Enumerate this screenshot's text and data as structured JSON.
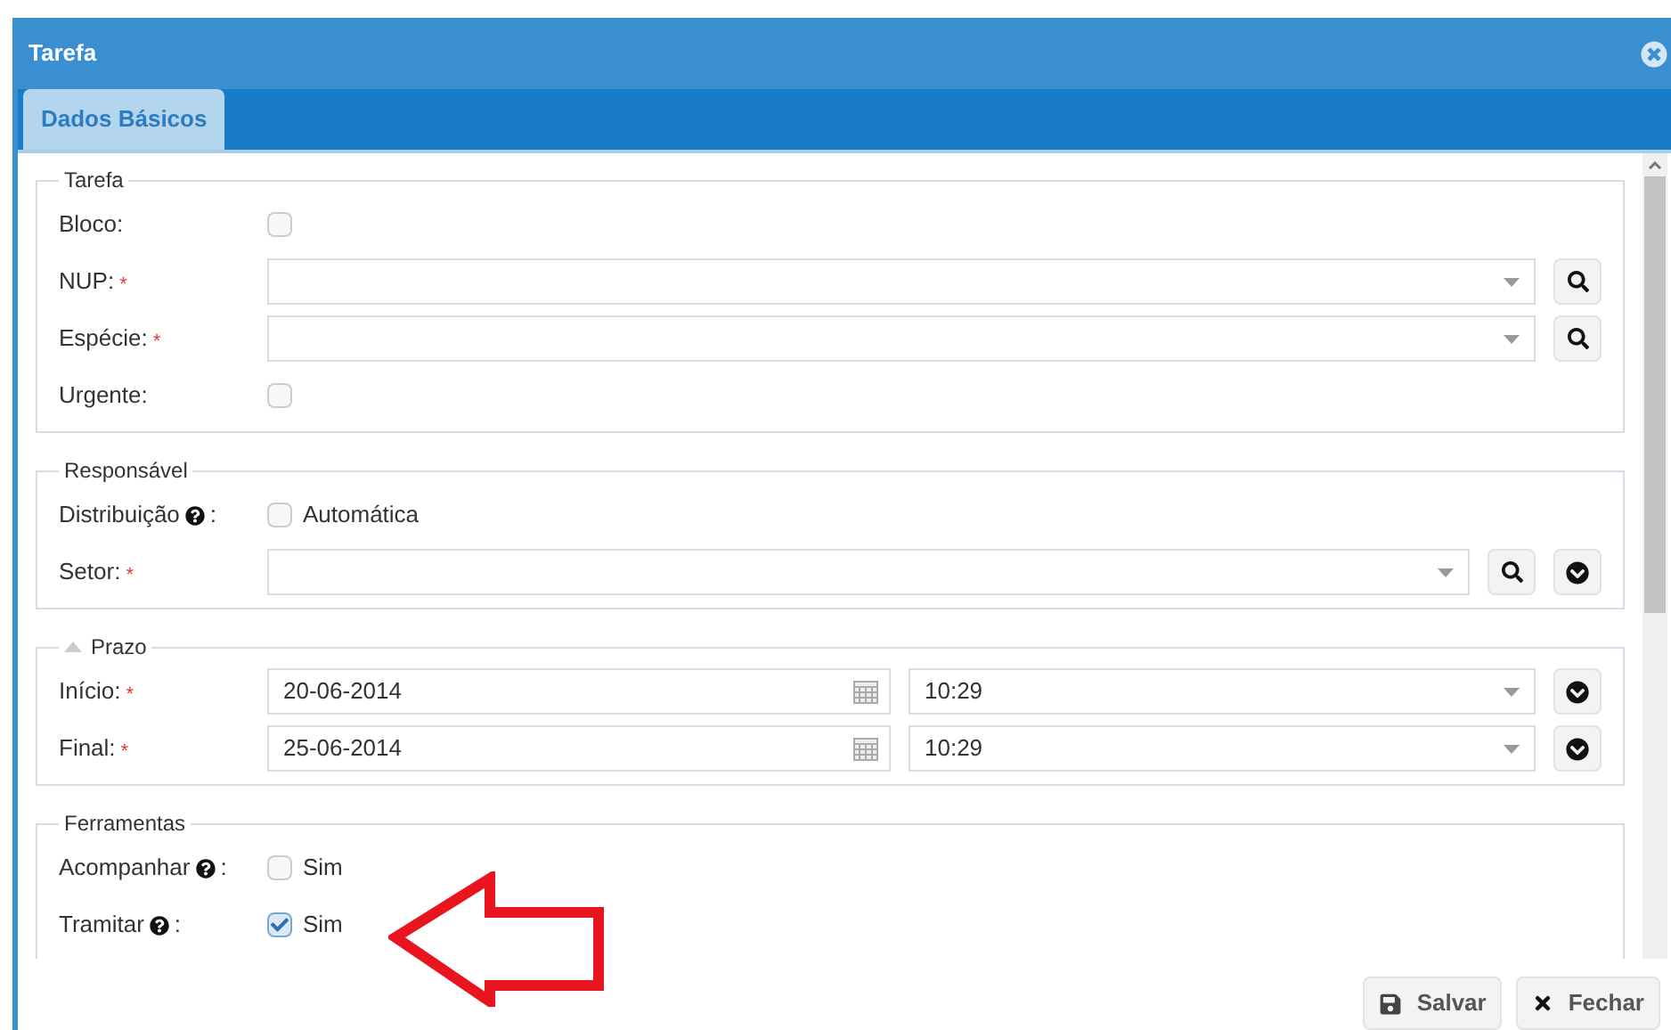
{
  "window": {
    "title": "Tarefa"
  },
  "tabs": [
    {
      "label": "Dados Básicos",
      "selected": true
    }
  ],
  "sections": [
    {
      "legend": "Tarefa",
      "rows": [
        {
          "kind": "checkbox",
          "label": "Bloco:",
          "checked": false
        },
        {
          "kind": "combo",
          "label": "NUP:",
          "required_mark": "*",
          "buttons": [
            {
              "kind": "search"
            }
          ]
        },
        {
          "kind": "combo",
          "label": "Espécie:",
          "required_mark": "*",
          "buttons": [
            {
              "kind": "search"
            }
          ]
        },
        {
          "kind": "checkbox",
          "label": "Urgente:",
          "checked": false
        }
      ]
    },
    {
      "legend": "Responsável",
      "rows": [
        {
          "kind": "checkbox",
          "label": "Distribuição",
          "help": true,
          "suffix": ":",
          "checked": false,
          "text": "Automática"
        },
        {
          "kind": "combo",
          "label": "Setor:",
          "required_mark": "*",
          "buttons": [
            {
              "kind": "search"
            },
            {
              "kind": "expand"
            }
          ]
        }
      ]
    },
    {
      "legend": "Prazo",
      "expanded": true,
      "rows": [
        {
          "kind": "datetime",
          "label": "Início:",
          "required_mark": "*",
          "date": "20-06-2014",
          "time": "10:29",
          "buttons": [
            {
              "kind": "expand"
            }
          ]
        },
        {
          "kind": "datetime",
          "label": "Final:",
          "required_mark": "*",
          "date": "25-06-2014",
          "time": "10:29",
          "buttons": [
            {
              "kind": "expand"
            }
          ]
        }
      ]
    },
    {
      "legend": "Ferramentas",
      "rows": [
        {
          "kind": "checkbox",
          "label": "Acompanhar",
          "help": true,
          "suffix": ":",
          "checked": false,
          "text": "Sim"
        },
        {
          "kind": "checkbox",
          "label": "Tramitar",
          "help": true,
          "suffix": ":",
          "checked": true,
          "text": "Sim"
        }
      ]
    }
  ],
  "buttons": [
    {
      "kind": "save",
      "label": "Salvar"
    },
    {
      "kind": "close",
      "label": "Fechar"
    }
  ]
}
